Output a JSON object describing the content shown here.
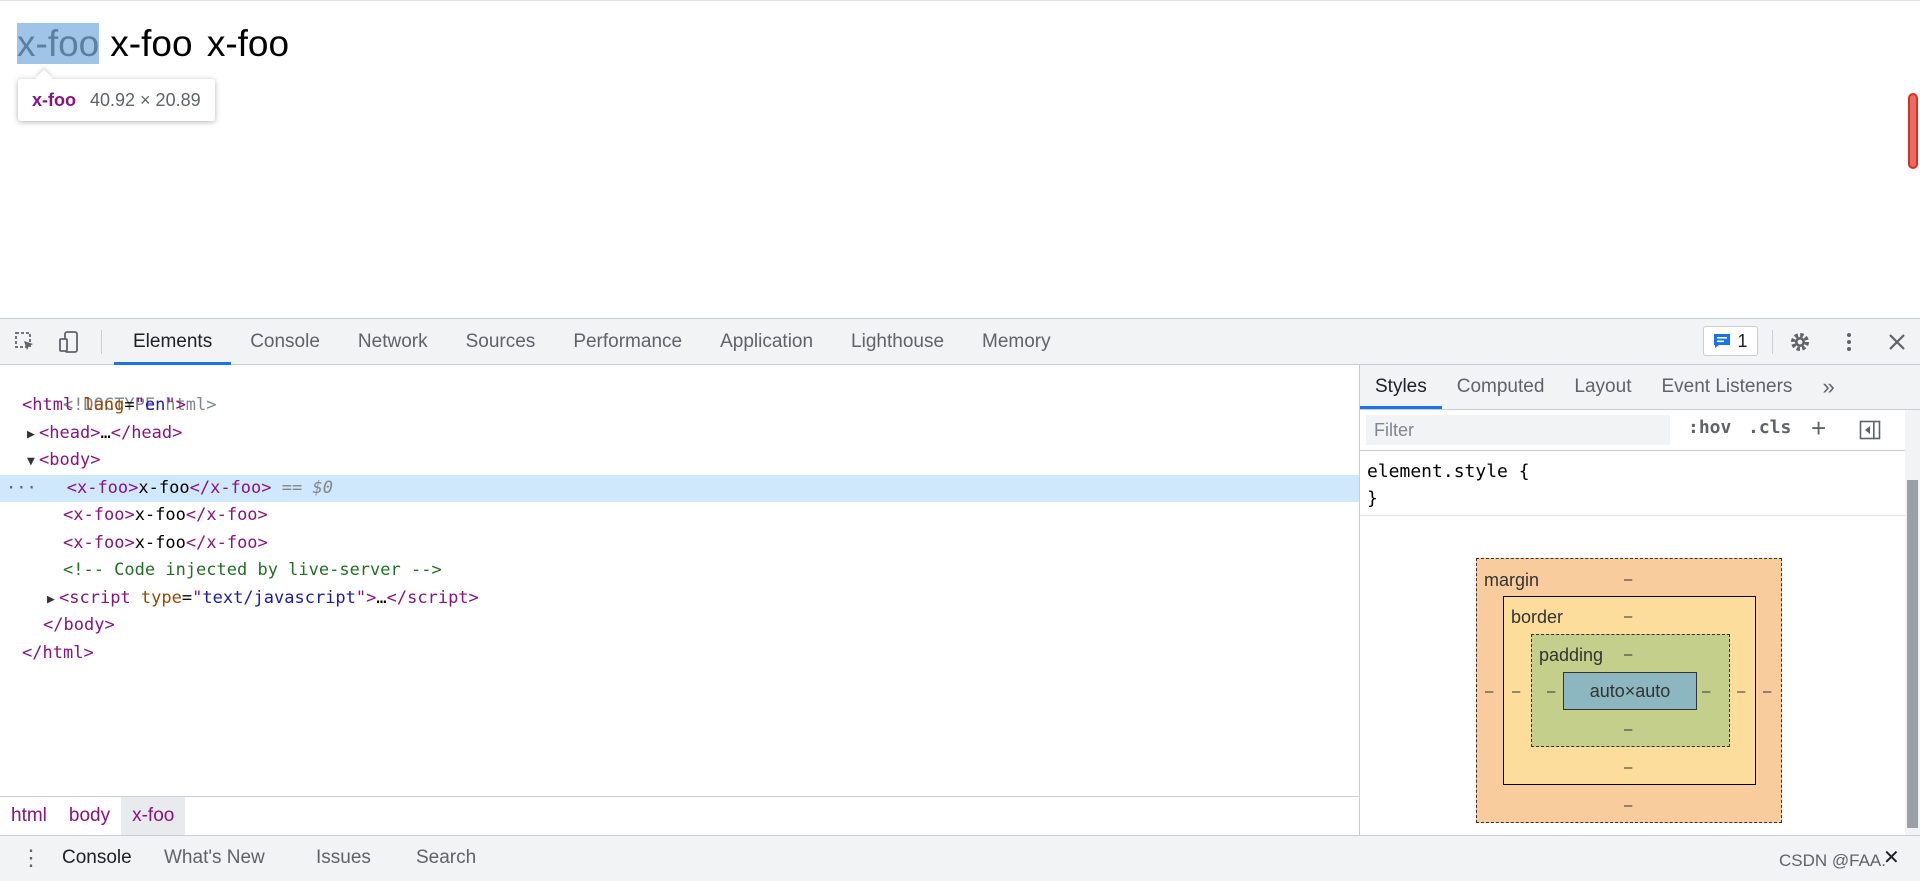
{
  "page": {
    "words": [
      "x-foo",
      "x-foo",
      "x-foo"
    ],
    "tooltip": {
      "tag": "x-foo",
      "dimensions": "40.92 × 20.89"
    }
  },
  "devtools": {
    "tabs": [
      "Elements",
      "Console",
      "Network",
      "Sources",
      "Performance",
      "Application",
      "Lighthouse",
      "Memory"
    ],
    "active_tab": "Elements",
    "issues_count": "1",
    "accent_color": "#1a73e8"
  },
  "elements": {
    "dom": {
      "doctype": "<!DOCTYPE html>",
      "html_open_tag": "html",
      "html_attr_name": "lang",
      "html_attr_value": "en",
      "head_tag": "head",
      "head_ellipsis": "…",
      "body_tag": "body",
      "x_foo_tag": "x-foo",
      "x_foo_text": "x-foo",
      "selected_marker": "== $0",
      "comment": "<!-- Code injected by live-server -->",
      "script_tag": "script",
      "script_attr_name": "type",
      "script_attr_value": "text/javascript",
      "script_ellipsis": "…",
      "gutter_dots": "···"
    },
    "breadcrumbs": [
      "html",
      "body",
      "x-foo"
    ]
  },
  "sidebar": {
    "tabs": [
      "Styles",
      "Computed",
      "Layout",
      "Event Listeners"
    ],
    "more_tabs": "»",
    "filter_placeholder": "Filter",
    "hov_label": ":hov",
    "cls_label": ".cls",
    "add_rule": "+",
    "rule_selector": "element.style {",
    "rule_close": "}",
    "box_model": {
      "margin_label": "margin",
      "border_label": "border",
      "padding_label": "padding",
      "content": "auto×auto",
      "dash": "–"
    }
  },
  "drawer": {
    "menu": "⋮",
    "tabs": [
      "Console",
      "What's New",
      "Issues",
      "Search"
    ],
    "close": "✕"
  },
  "watermark": "CSDN @FAA."
}
